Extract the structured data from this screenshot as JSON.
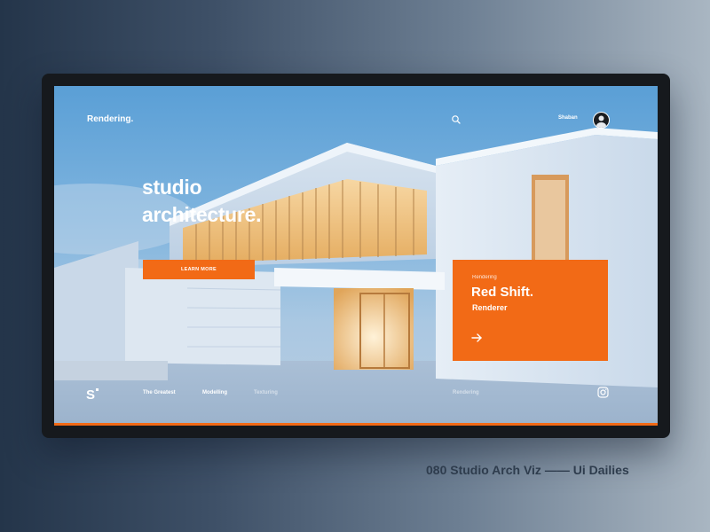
{
  "header": {
    "brand": "Rendering.",
    "search_icon": "search-icon",
    "user_name": "Shaban",
    "avatar_icon": "avatar-icon"
  },
  "hero": {
    "title_line1": "studio",
    "title_line2": "architecture.",
    "cta_label": "LEARN MORE"
  },
  "promo": {
    "eyebrow": "Rendering",
    "title": "Red Shift.",
    "subtitle": "Renderer",
    "arrow_icon": "arrow-right-icon"
  },
  "footer_nav": {
    "logo": "S",
    "items": [
      {
        "label": "The Greatest",
        "active": true
      },
      {
        "label": "Modelling",
        "active": true
      },
      {
        "label": "Texturing",
        "active": false
      },
      {
        "label": "Rendering",
        "active": false
      }
    ],
    "social_icon": "instagram-icon"
  },
  "caption": {
    "text": "080 Studio Arch Viz —— Ui Dailies"
  },
  "colors": {
    "accent": "#f26a16",
    "device_frame": "#16191d",
    "sky": "#5a9fd6"
  }
}
